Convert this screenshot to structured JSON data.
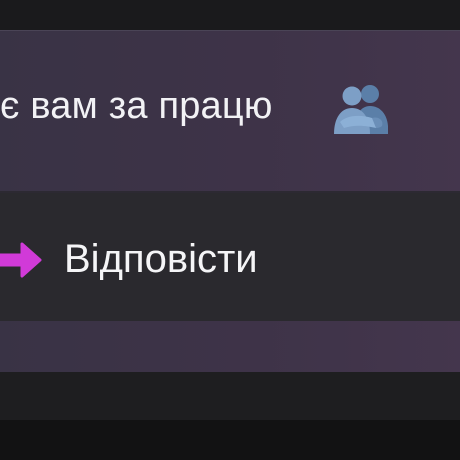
{
  "message": {
    "text": "є вам за працю",
    "emoji_icon": "people-hugging-icon"
  },
  "context_menu": {
    "reply": {
      "label": "Відповісти",
      "icon": "reply-arrow-icon",
      "icon_color": "#d13ad8"
    }
  },
  "colors": {
    "card_background": "#3e3348",
    "menu_background": "#2a292e",
    "screen_background": "#1c1c1e",
    "text": "#f2f2f5",
    "accent": "#d13ad8"
  }
}
